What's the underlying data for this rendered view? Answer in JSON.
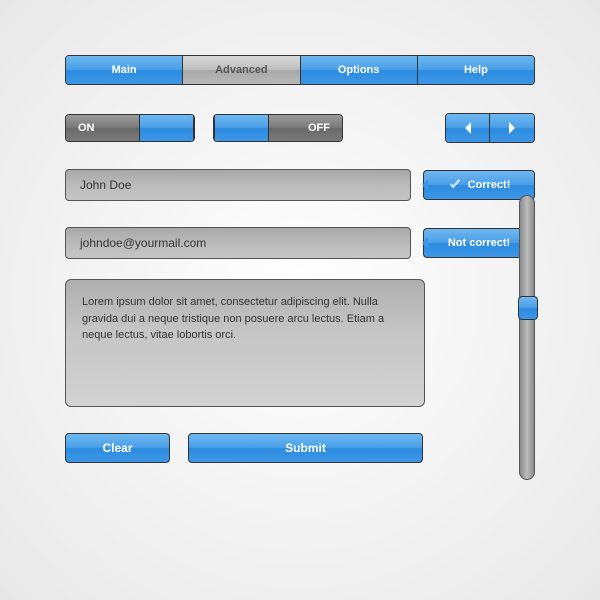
{
  "tabs": {
    "main": "Main",
    "advanced": "Advanced",
    "options": "Options",
    "help": "Help"
  },
  "toggles": {
    "on_label": "ON",
    "off_label": "OFF"
  },
  "inputs": {
    "name": "John Doe",
    "email": "johndoe@yourmail.com"
  },
  "badges": {
    "correct": "Correct!",
    "incorrect": "Not correct!"
  },
  "textarea": "Lorem ipsum dolor sit amet, consectetur adipiscing elit. Nulla gravida dui a neque tristique non posuere arcu lectus. Etiam a neque lectus, vitae lobortis orci.",
  "buttons": {
    "clear": "Clear",
    "submit": "Submit"
  }
}
